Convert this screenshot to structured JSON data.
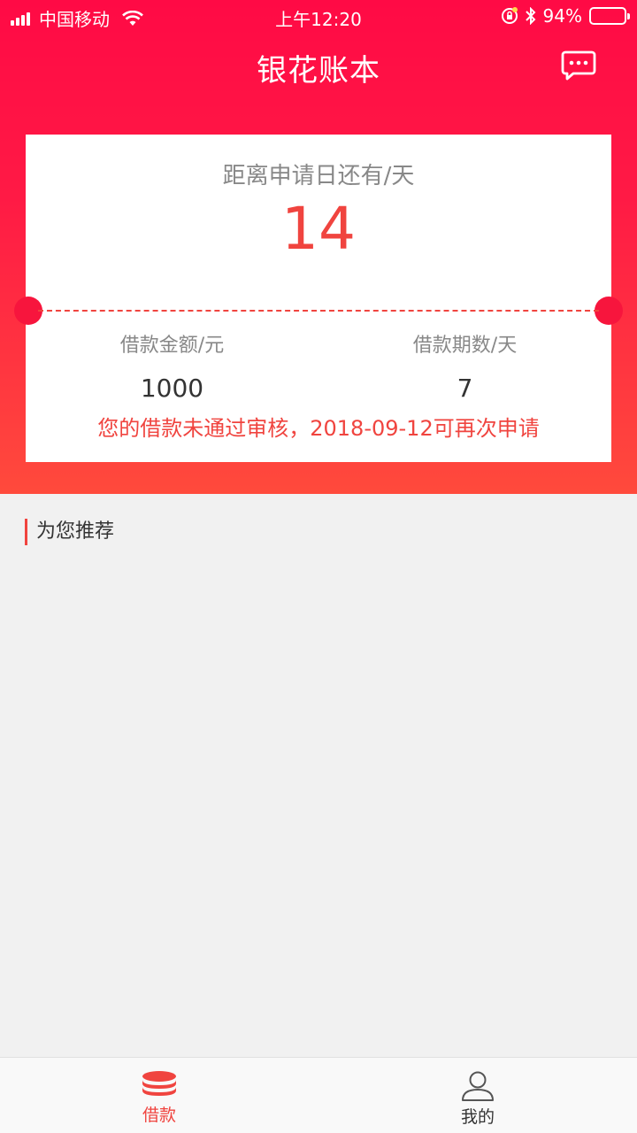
{
  "status_bar": {
    "carrier": "中国移动",
    "time": "上午12:20",
    "battery": "94%",
    "battery_level": 0.94
  },
  "nav": {
    "title": "银花账本",
    "message_icon": "chat-bubble-icon"
  },
  "card": {
    "countdown_label": "距离申请日还有/天",
    "countdown_value": "14",
    "amount_label": "借款金额/元",
    "amount_value": "1000",
    "period_label": "借款期数/天",
    "period_value": "7",
    "notice": "您的借款未通过审核，2018-09-12可再次申请"
  },
  "section": {
    "title": "为您推荐"
  },
  "tabbar": {
    "items": [
      {
        "label": "借款",
        "icon": "coins-stack-icon",
        "active": true
      },
      {
        "label": "我的",
        "icon": "user-icon",
        "active": false
      }
    ]
  },
  "colors": {
    "brand_red": "#ff0a45",
    "accent": "#f0443f"
  }
}
